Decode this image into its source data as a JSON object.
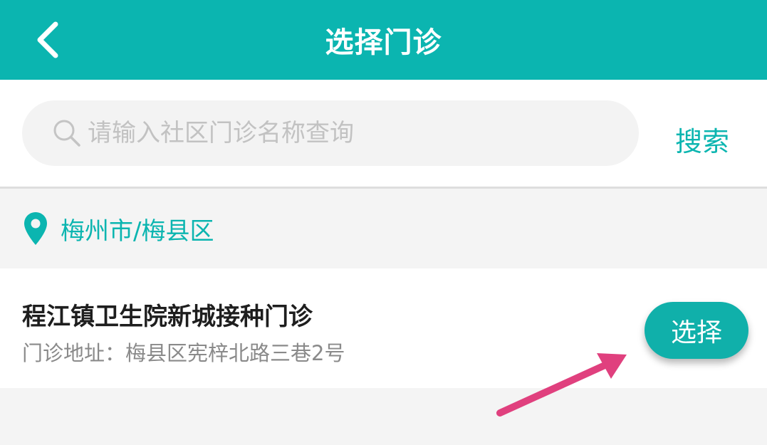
{
  "header": {
    "title": "选择门诊",
    "back_icon": "chevron-left-icon"
  },
  "search": {
    "placeholder": "请输入社区门诊名称查询",
    "value": "",
    "button_label": "搜索",
    "icon": "search-icon"
  },
  "location": {
    "icon": "map-pin-icon",
    "label": "梅州市/梅县区"
  },
  "clinics": [
    {
      "name": "程江镇卫生院新城接种门诊",
      "address": "门诊地址：梅县区宪梓北路三巷2号",
      "select_label": "选择"
    }
  ],
  "colors": {
    "accent": "#0bb5b0",
    "annotation_arrow": "#e0407e"
  }
}
